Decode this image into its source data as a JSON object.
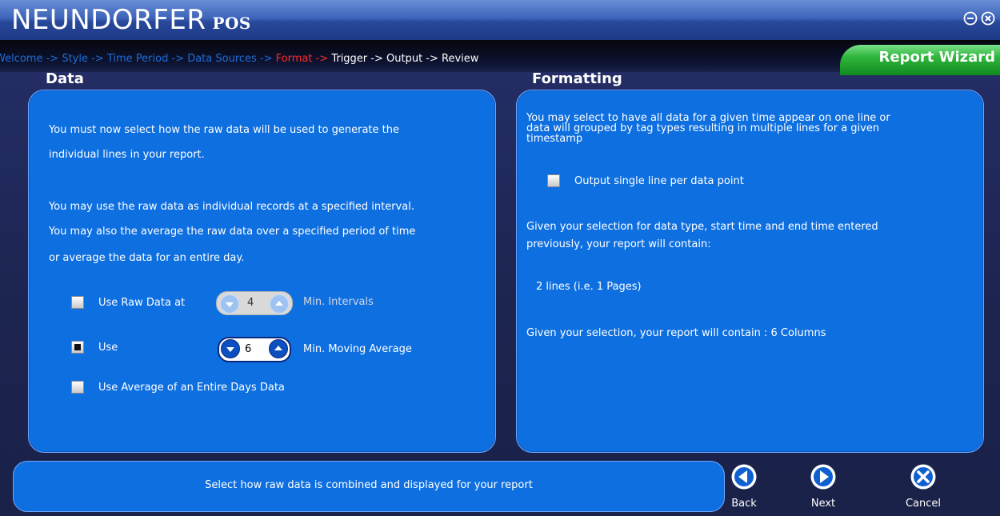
{
  "app": {
    "brand": "NEUNDORFER",
    "brand_sub": "POS",
    "wizard_label": "Report Wizard"
  },
  "window_controls": [
    {
      "icon": "minimize-icon"
    },
    {
      "icon": "close-icon"
    }
  ],
  "breadcrumb": [
    {
      "label": "Welcome ->",
      "state": "done"
    },
    {
      "label": "Style ->",
      "state": "done"
    },
    {
      "label": "Time Period ->",
      "state": "done"
    },
    {
      "label": "Data Sources ->",
      "state": "done"
    },
    {
      "label": "Format ->",
      "state": "current"
    },
    {
      "label": "Trigger ->",
      "state": "future"
    },
    {
      "label": "Output ->",
      "state": "future"
    },
    {
      "label": "Review",
      "state": "future"
    }
  ],
  "data_panel": {
    "title": "Data",
    "para1_line1": "You must now select how the raw data will be used to generate the",
    "para1_line2": "individual lines in your report.",
    "para2_line1": "You may use the raw data as individual records at a specified interval.",
    "para2_line2": "You may also the average the raw data over a specified period of time",
    "para2_line3": "or average the data for an entire day.",
    "option_raw": {
      "label": "Use Raw Data at",
      "checked": false,
      "value": "4",
      "unit": "Min. Intervals"
    },
    "option_use": {
      "label": "Use",
      "checked": true,
      "value": "6",
      "unit": "Min. Moving Average"
    },
    "option_day": {
      "label": "Use Average of an Entire Days Data",
      "checked": false
    }
  },
  "formatting_panel": {
    "title": "Formatting",
    "intro_line1": "You may select to have all data for a given time appear on one line or",
    "intro_line2": "data will grouped by tag types resulting in multiple lines for a given",
    "intro_line3": "timestamp",
    "single_line_option": {
      "label": "Output single line per data point",
      "checked": false
    },
    "summary_line1": "Given your selection for data type, start time and end time entered",
    "summary_line2": "previously, your report will contain:",
    "lines_result": "2 lines (i.e. 1 Pages)",
    "columns_result": "Given your selection, your report will contain : 6 Columns"
  },
  "status": {
    "message": "Select how raw data is combined and displayed for your report"
  },
  "nav": {
    "back": "Back",
    "next": "Next",
    "cancel": "Cancel"
  },
  "colors": {
    "panel": "#0e6fe0",
    "current_step": "#ff2a2a",
    "done_step": "#1d6ed8",
    "wizard_tab": "#2fb63c"
  }
}
